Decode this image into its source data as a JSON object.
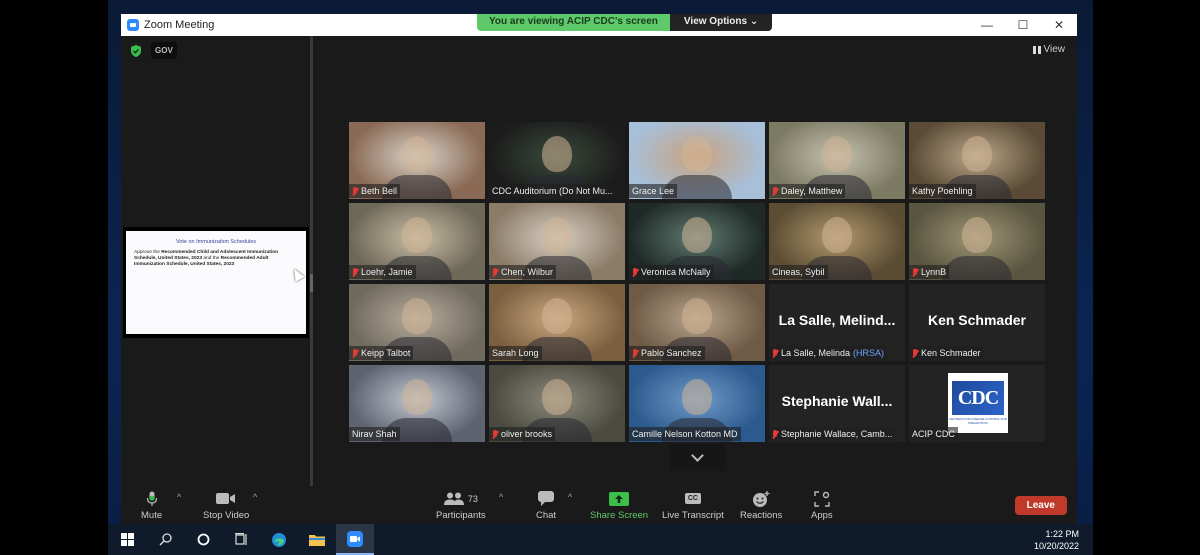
{
  "window": {
    "title": "Zoom Meeting",
    "controls": {
      "minimize": "—",
      "maximize": "☐",
      "close": "✕"
    }
  },
  "share_banner": {
    "text": "You are viewing ACIP CDC's screen",
    "view_options": "View Options ⌄"
  },
  "badges": {
    "security": "shield-check",
    "gov": "GOV"
  },
  "view_button": {
    "label": "View"
  },
  "shared_slide": {
    "title": "Vote on Immunization Schedules",
    "body_prefix": "Approve the ",
    "body_bold1": "Recommended Child and Adolescent Immunization Schedule, United States, 2023",
    "body_mid": " and the ",
    "body_bold2": "Recommended Adult Immunization Schedule, United States, 2023"
  },
  "participants": [
    {
      "name": "Beth Bell",
      "muted": true,
      "video": true,
      "colors": [
        "#8a6a55",
        "#d9d2c8"
      ]
    },
    {
      "name": "CDC Auditorium (Do Not Mu...",
      "muted": false,
      "video": true,
      "active_speaker": true,
      "colors": [
        "#1c1c1c",
        "#3a4a3a"
      ]
    },
    {
      "name": "Grace Lee",
      "muted": false,
      "video": true,
      "colors": [
        "#a7bfd8",
        "#c9a27d"
      ]
    },
    {
      "name": "Daley, Matthew",
      "muted": true,
      "video": true,
      "colors": [
        "#7d7a64",
        "#c5c2b0"
      ]
    },
    {
      "name": "Kathy Poehling",
      "muted": false,
      "video": true,
      "colors": [
        "#5b4a35",
        "#b9a88a"
      ]
    },
    {
      "name": "Loehr, Jamie",
      "muted": true,
      "video": true,
      "colors": [
        "#6e6858",
        "#c9bea5"
      ]
    },
    {
      "name": "Chen, Wilbur",
      "muted": true,
      "video": true,
      "colors": [
        "#8b7c68",
        "#d7cfc2"
      ]
    },
    {
      "name": "Veronica McNally",
      "muted": true,
      "video": true,
      "colors": [
        "#1f2a26",
        "#5f7a70"
      ]
    },
    {
      "name": "Cineas, Sybil",
      "muted": false,
      "video": true,
      "colors": [
        "#5b4c34",
        "#b39a6c"
      ]
    },
    {
      "name": "LynnB",
      "muted": true,
      "video": true,
      "colors": [
        "#5a5540",
        "#9e9676"
      ]
    },
    {
      "name": "Keipp Talbot",
      "muted": true,
      "video": true,
      "colors": [
        "#706a5e",
        "#b7ad9c"
      ]
    },
    {
      "name": "Sarah Long",
      "muted": false,
      "video": true,
      "colors": [
        "#7b6040",
        "#c9a87e"
      ]
    },
    {
      "name": "Pablo Sanchez",
      "muted": true,
      "video": true,
      "colors": [
        "#6e5a45",
        "#b9a48c"
      ]
    },
    {
      "name": "La Salle, Melinda",
      "org": "(HRSA)",
      "muted": true,
      "video": false,
      "display_name": "La Salle, Melind..."
    },
    {
      "name": "Ken Schmader",
      "muted": true,
      "video": false,
      "display_name": "Ken Schmader"
    },
    {
      "name": "Nirav Shah",
      "muted": false,
      "video": true,
      "colors": [
        "#5d6470",
        "#c3c9d2"
      ]
    },
    {
      "name": "oliver brooks",
      "muted": true,
      "video": true,
      "colors": [
        "#4a4a40",
        "#8d8b7c"
      ]
    },
    {
      "name": "Camille Nelson Kotton MD",
      "muted": false,
      "video": true,
      "colors": [
        "#2d5a8e",
        "#6e9bc9"
      ]
    },
    {
      "name": "Stephanie Wallace, Camb...",
      "muted": true,
      "video": false,
      "display_name": "Stephanie  Wall..."
    },
    {
      "name": "ACIP CDC",
      "muted": false,
      "video": false,
      "logo": "CDC"
    }
  ],
  "cdc_logo": {
    "text": "CDC",
    "subtext": "CENTERS FOR DISEASE CONTROL AND PREVENTION"
  },
  "toolbar": {
    "mute": "Mute",
    "stop_video": "Stop Video",
    "participants": "Participants",
    "participant_count": "73",
    "chat": "Chat",
    "share_screen": "Share Screen",
    "live_transcript": "Live Transcript",
    "cc": "CC",
    "reactions": "Reactions",
    "apps": "Apps",
    "leave": "Leave"
  },
  "colors": {
    "share_green": "#5dc96a",
    "leave_red": "#c0392b",
    "mute_red": "#e23a36",
    "active_outline": "#c9e07a",
    "zoom_blue": "#2d8cff"
  },
  "taskbar": {
    "time": "1:22 PM",
    "date": "10/20/2022",
    "apps": [
      "windows-start",
      "search",
      "cortana",
      "task-view",
      "edge",
      "file-explorer",
      "zoom"
    ]
  }
}
